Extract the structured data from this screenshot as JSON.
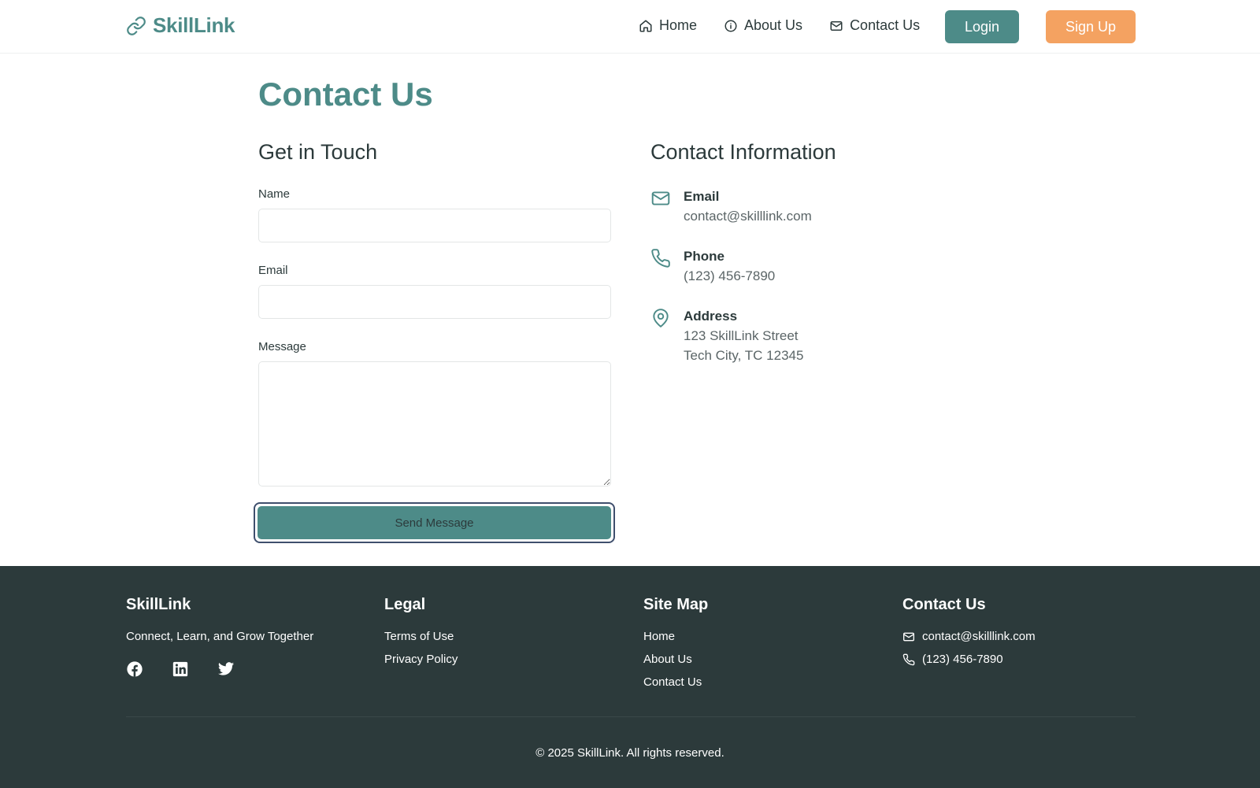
{
  "nav": {
    "brand": "SkillLink",
    "links": [
      {
        "label": "Home",
        "icon": "home-icon"
      },
      {
        "label": "About Us",
        "icon": "info-icon"
      },
      {
        "label": "Contact Us",
        "icon": "mail-icon"
      }
    ],
    "login": "Login",
    "signup": "Sign Up"
  },
  "main": {
    "title": "Contact Us",
    "form": {
      "heading": "Get in Touch",
      "name_label": "Name",
      "name_value": "",
      "email_label": "Email",
      "email_value": "",
      "message_label": "Message",
      "message_value": "",
      "submit": "Send Message"
    },
    "info": {
      "heading": "Contact Information",
      "email_title": "Email",
      "email_value": "contact@skilllink.com",
      "phone_title": "Phone",
      "phone_value": "(123) 456-7890",
      "address_title": "Address",
      "address_line1": "123 SkillLink Street",
      "address_line2": "Tech City, TC 12345"
    }
  },
  "footer": {
    "brand": "SkillLink",
    "tagline": "Connect, Learn, and Grow Together",
    "legal_heading": "Legal",
    "legal_links": [
      "Terms of Use",
      "Privacy Policy"
    ],
    "sitemap_heading": "Site Map",
    "sitemap_links": [
      "Home",
      "About Us",
      "Contact Us"
    ],
    "contact_heading": "Contact Us",
    "contact_email": "contact@skilllink.com",
    "contact_phone": "(123) 456-7890",
    "social": [
      "facebook-icon",
      "linkedin-icon",
      "twitter-icon"
    ],
    "copyright": "© 2025 SkillLink. All rights reserved."
  },
  "colors": {
    "primary": "#4d8b88",
    "accent": "#f4a261",
    "footer_bg": "#2c3a3b",
    "text": "#2c3a3b"
  }
}
